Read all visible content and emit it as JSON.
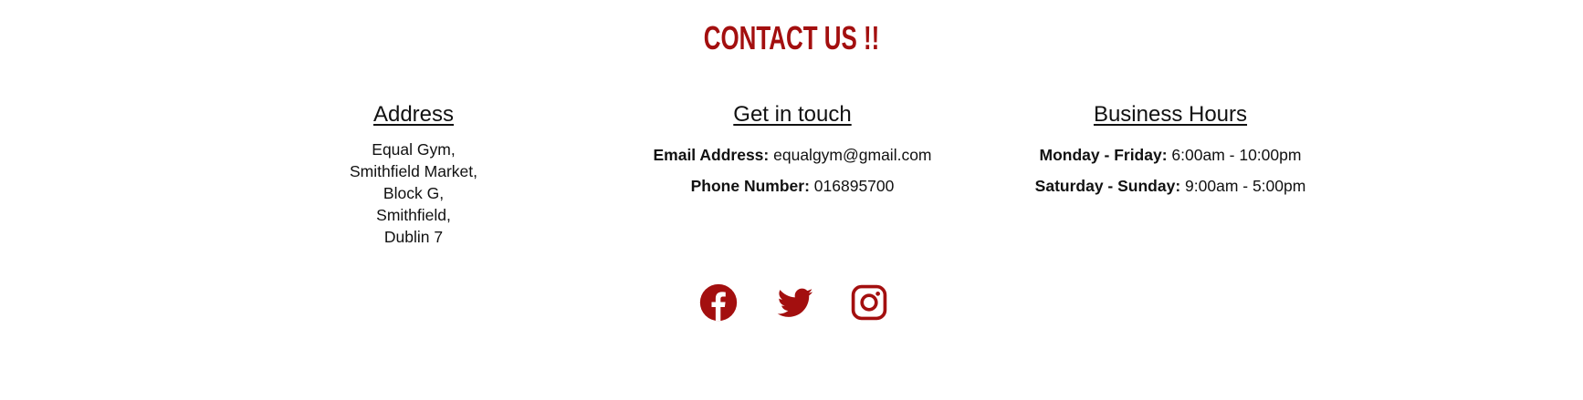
{
  "contact": {
    "title": "CONTACT US !!"
  },
  "address": {
    "heading": "Address",
    "lines": [
      "Equal Gym,",
      "Smithfield Market,",
      "Block G,",
      "Smithfield,",
      "Dublin 7"
    ]
  },
  "get_in_touch": {
    "heading": "Get in touch",
    "email_label": "Email Address:",
    "email_value": "equalgym@gmail.com",
    "phone_label": "Phone Number:",
    "phone_value": "016895700"
  },
  "business_hours": {
    "heading": "Business Hours",
    "weekday_label": "Monday - Friday:",
    "weekday_value": "6:00am - 10:00pm",
    "weekend_label": "Saturday - Sunday:",
    "weekend_value": "9:00am - 5:00pm"
  },
  "social": {
    "icons": [
      "facebook-icon",
      "twitter-icon",
      "instagram-icon"
    ],
    "color": "#a30f0f"
  }
}
